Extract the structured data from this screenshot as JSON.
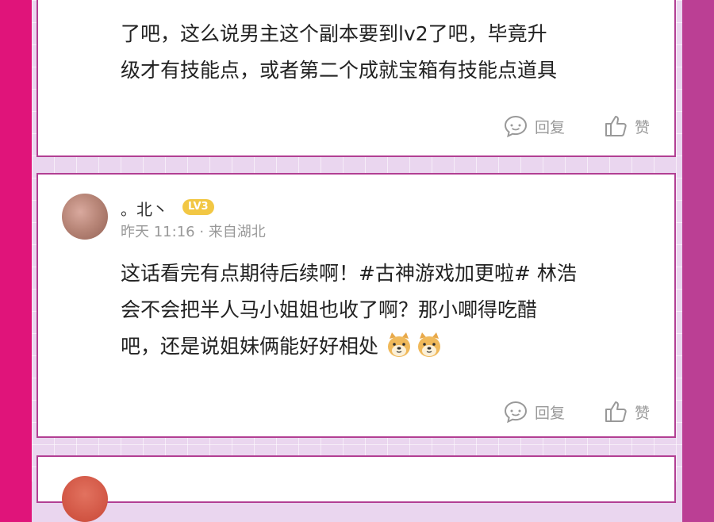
{
  "comments": [
    {
      "lines": [
        "了吧，这么说男主这个副本要到lv2了吧，毕竟升",
        "级才有技能点，或者第二个成就宝箱有技能点道具"
      ],
      "reply_label": "回复",
      "like_label": "赞"
    },
    {
      "username": "。北丶",
      "level": "LV3",
      "meta": "昨天 11:16 · 来自湖北",
      "lines": [
        "这话看完有点期待后续啊！#古神游戏加更啦# 林浩",
        "会不会把半人马小姐姐也收了啊？那小唧得吃醋",
        "吧，还是说姐妹俩能好好相处"
      ],
      "emojis": [
        "doge-emoji",
        "doge-emoji"
      ],
      "reply_label": "回复",
      "like_label": "赞"
    }
  ],
  "icons": [
    "comment-icon",
    "thumbs-up-icon"
  ],
  "colors": {
    "card_border": "#b23f93",
    "left_bar": "#e0147a",
    "right_bar": "#bb3f94",
    "level_badge": "#f2c744",
    "meta_text": "#999999"
  }
}
